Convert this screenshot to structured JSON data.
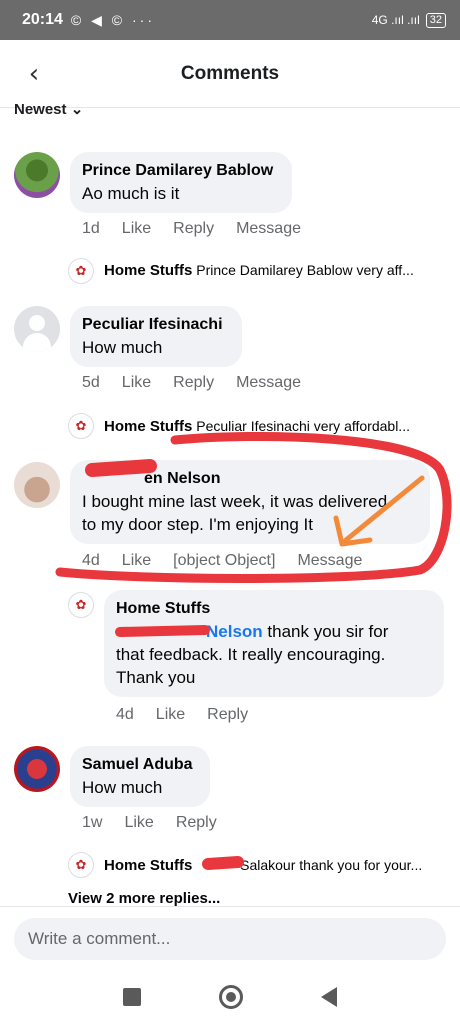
{
  "status_bar": {
    "time": "20:14",
    "icons": "© ◀ ©  ···",
    "network": "4G .ııl .ııl",
    "battery": "32"
  },
  "header": {
    "title": "Comments",
    "back_icon": "‹"
  },
  "sort": {
    "label": "Newest ⌄"
  },
  "comments": [
    {
      "name": "Prince Damilarey Bablow",
      "text": "Ao much is it",
      "time": "1d",
      "like": "Like",
      "reply": "Reply",
      "message": "Message",
      "reply_preview": {
        "name": "Home Stuffs",
        "text": "Prince Damilarey Bablow very aff..."
      }
    },
    {
      "name": "Peculiar Ifesinachi",
      "text": "How much",
      "time": "5d",
      "like": "Like",
      "reply": "Reply",
      "message": "Message",
      "reply_preview": {
        "name": "Home Stuffs",
        "text": "Peculiar Ifesinachi  very affordabl..."
      }
    },
    {
      "name": "en Nelson",
      "text_line1": "I bought mine last week, it was delivered",
      "text_line2": "to my door step. I'm enjoying It",
      "time": "4d",
      "like": "Like",
      "reply": {
        "name": "Home Stuffs",
        "mention": "Nelson",
        "text_line1": " thank you sir for",
        "text_line2": "that feedback. It really encouraging.",
        "text_line3": "Thank you",
        "time": "4d",
        "like": "Like",
        "reply": "Reply"
      },
      "message": "Message"
    },
    {
      "name": "Samuel Aduba",
      "text": "How much",
      "time": "1w",
      "like": "Like",
      "reply": "Reply",
      "reply_preview": {
        "name": "Home Stuffs",
        "text": "Salakour thank you for your..."
      }
    }
  ],
  "view_more": "View 2 more replies...",
  "composer": {
    "placeholder": "Write a comment..."
  },
  "annotation_colors": {
    "circle": "#e8383d",
    "arrow": "#f28a3a"
  }
}
